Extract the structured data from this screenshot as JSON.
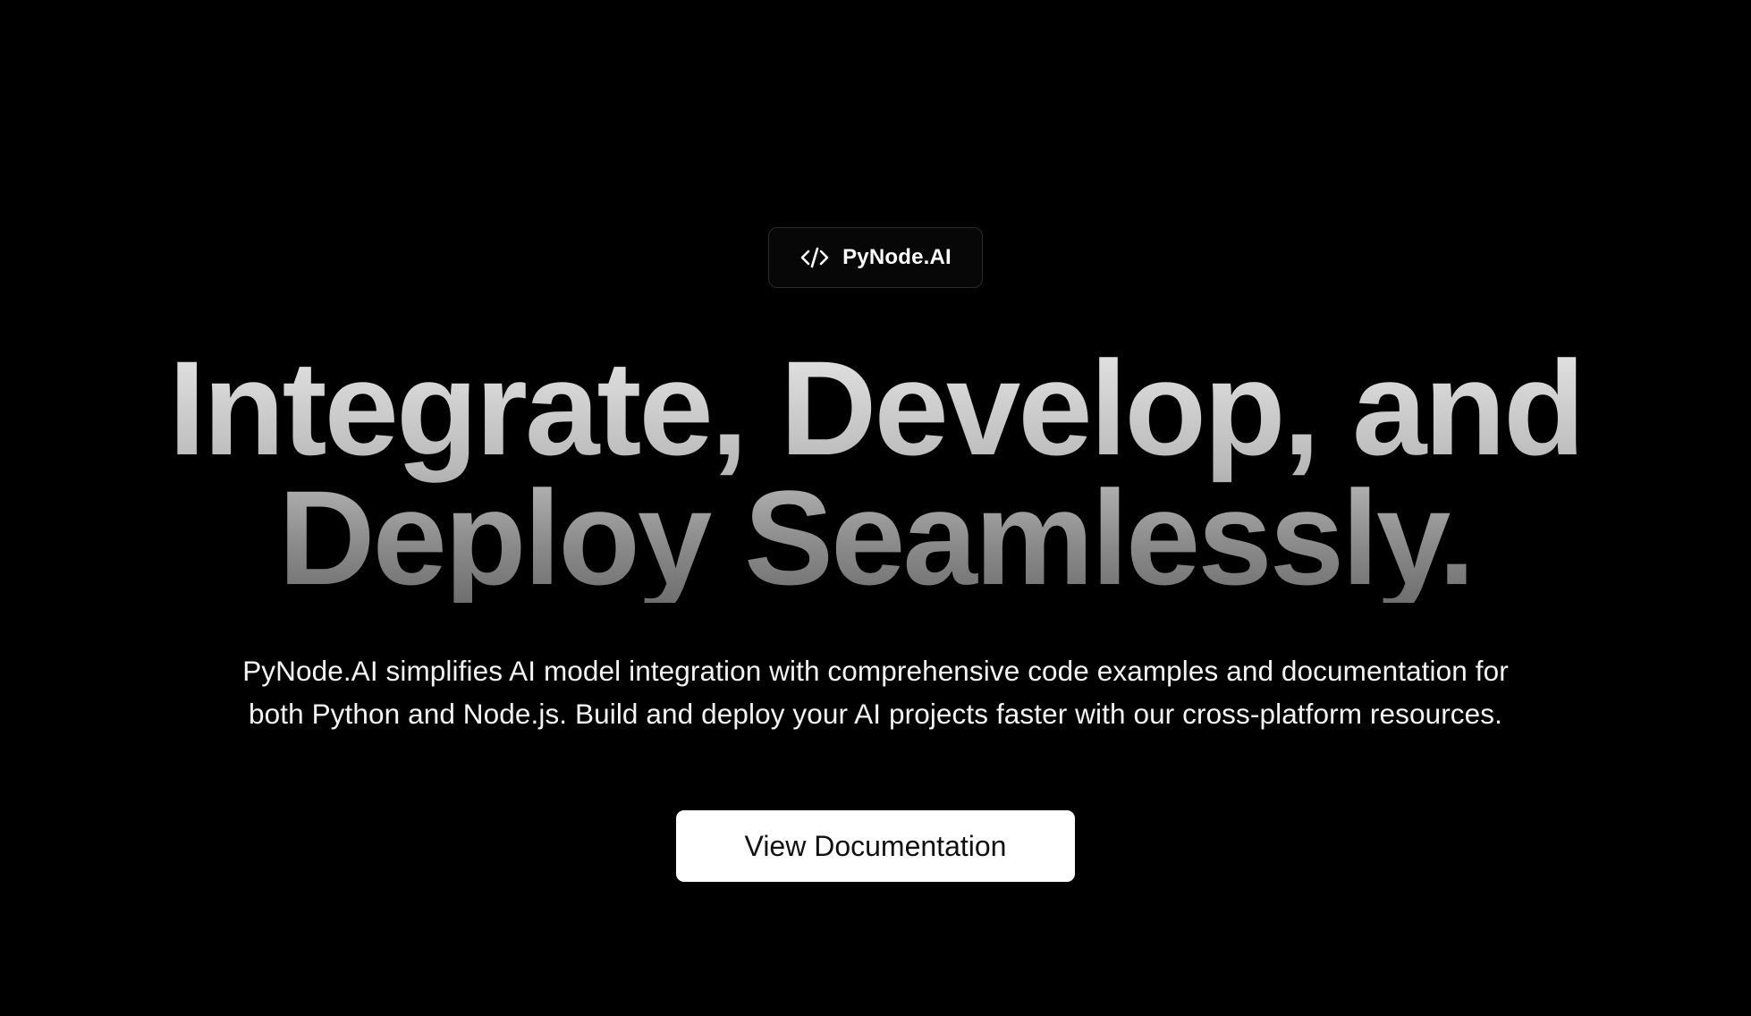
{
  "badge": {
    "icon": "code-icon",
    "label": "PyNode.AI"
  },
  "hero": {
    "headline_line1": "Integrate, Develop, and",
    "headline_line2": "Deploy Seamlessly.",
    "subtitle_line1": "PyNode.AI simplifies AI model integration with comprehensive code examples and documentation for",
    "subtitle_line2": "both Python and Node.js. Build and deploy your AI projects faster with our cross-platform resources."
  },
  "cta": {
    "label": "View Documentation"
  },
  "colors": {
    "background": "#000000",
    "badge_border": "#2b2b2b",
    "headline_gradient_top": "#e4e4e4",
    "headline_gradient_bottom": "#6f6f6f",
    "text": "#ffffff",
    "button_bg": "#ffffff",
    "button_text": "#111111"
  }
}
